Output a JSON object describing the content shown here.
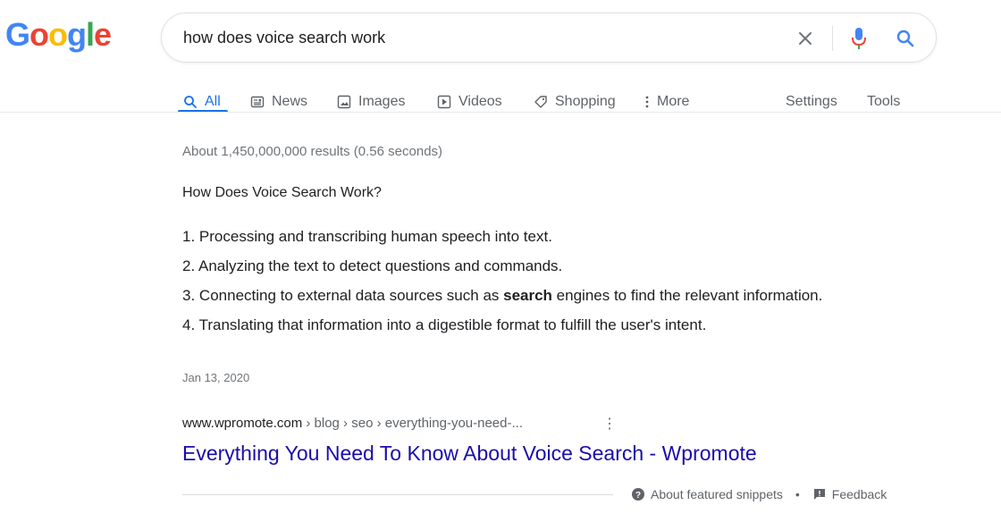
{
  "logo": {
    "text": "Google",
    "letters": [
      "G",
      "o",
      "o",
      "g",
      "l",
      "e"
    ],
    "colors": [
      "#4285f4",
      "#ea4335",
      "#fbbc05",
      "#4285f4",
      "#34a853",
      "#ea4335"
    ]
  },
  "search": {
    "query": "how does voice search work",
    "icons": [
      "close-icon",
      "mic-icon",
      "search-icon"
    ]
  },
  "tabs": [
    {
      "label": "All",
      "icon": "search-icon",
      "active": true
    },
    {
      "label": "News",
      "icon": "news-icon"
    },
    {
      "label": "Images",
      "icon": "image-icon"
    },
    {
      "label": "Videos",
      "icon": "play-icon"
    },
    {
      "label": "Shopping",
      "icon": "tag-icon"
    },
    {
      "label": "More",
      "icon": "more-vert-icon"
    }
  ],
  "tools": {
    "settings": "Settings",
    "tools": "Tools"
  },
  "results": {
    "stats": "About 1,450,000,000 results (0.56 seconds)",
    "snippet": {
      "heading": "How Does Voice Search Work?",
      "items": [
        {
          "num": "1.",
          "text": "Processing and transcribing human speech into text."
        },
        {
          "num": "2.",
          "text": "Analyzing the text to detect questions and commands."
        },
        {
          "num": "3.",
          "pre": "Connecting to external data sources such as ",
          "bold": "search",
          "post": " engines to find the relevant information."
        },
        {
          "num": "4.",
          "text": "Translating that information into a digestible format to fulfill the user's intent."
        }
      ],
      "date": "Jan 13, 2020",
      "cite_domain": "www.wpromote.com",
      "cite_path": " › blog › seo › everything-you-need-...",
      "title": "Everything You Need To Know About Voice Search - Wpromote"
    },
    "footer": {
      "about": "About featured snippets",
      "dot": "•",
      "feedback": "Feedback"
    }
  }
}
